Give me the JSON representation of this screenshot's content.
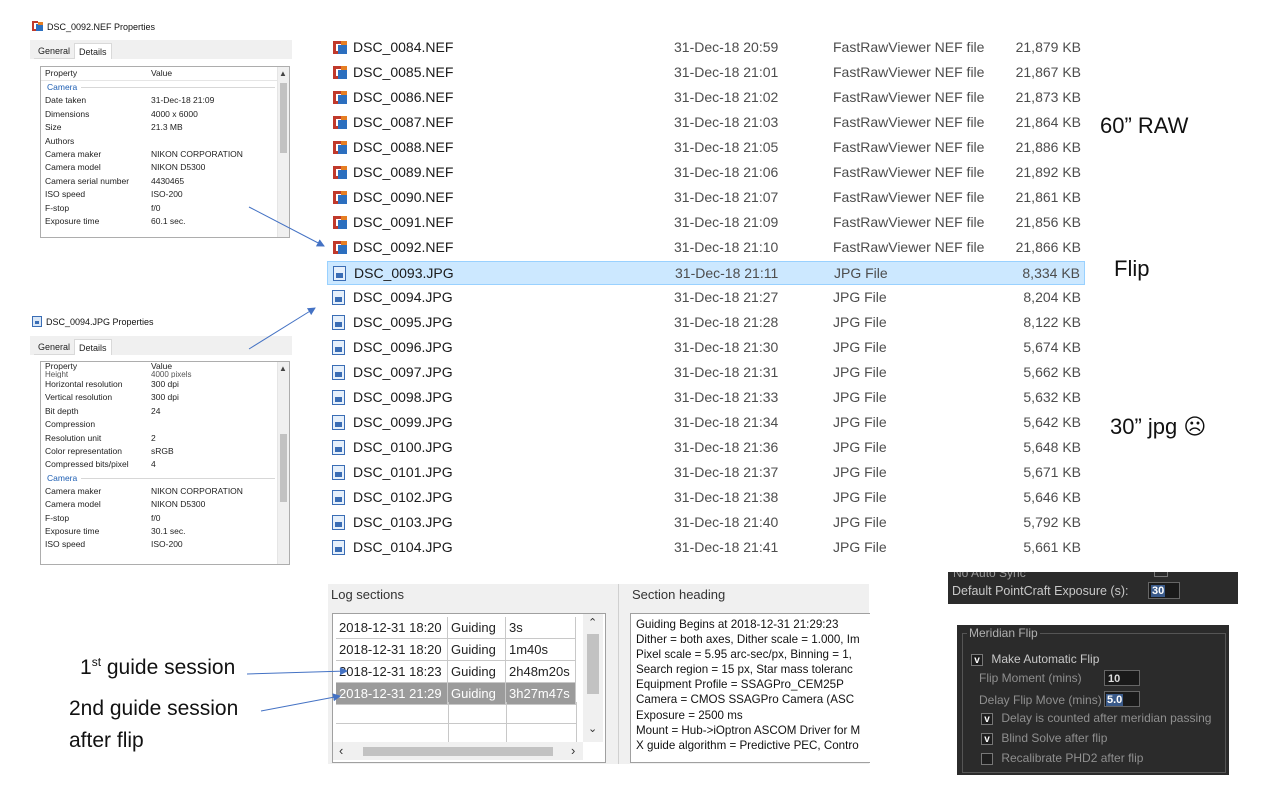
{
  "nef_dialog": {
    "title": "DSC_0092.NEF Properties",
    "tabs": [
      "General",
      "Details"
    ],
    "headers": {
      "property": "Property",
      "value": "Value"
    },
    "section": "Camera",
    "rows": [
      {
        "k": "Date taken",
        "v": "31-Dec-18 21:09"
      },
      {
        "k": "Dimensions",
        "v": "4000 x 6000"
      },
      {
        "k": "Size",
        "v": "21.3 MB"
      },
      {
        "k": "Authors",
        "v": ""
      },
      {
        "k": "Camera maker",
        "v": "NIKON CORPORATION"
      },
      {
        "k": "Camera model",
        "v": "NIKON D5300"
      },
      {
        "k": "Camera serial number",
        "v": "4430465"
      },
      {
        "k": "ISO speed",
        "v": "ISO-200"
      },
      {
        "k": "F-stop",
        "v": "f/0"
      },
      {
        "k": "Exposure time",
        "v": "60.1 sec."
      }
    ]
  },
  "jpg_dialog": {
    "title": "DSC_0094.JPG Properties",
    "tabs": [
      "General",
      "Details"
    ],
    "headers": {
      "property": "Property",
      "value": "Value"
    },
    "partial_row": {
      "k": "Height",
      "v": "4000 pixels"
    },
    "rows": [
      {
        "k": "Horizontal resolution",
        "v": "300 dpi"
      },
      {
        "k": "Vertical resolution",
        "v": "300 dpi"
      },
      {
        "k": "Bit depth",
        "v": "24"
      },
      {
        "k": "Compression",
        "v": ""
      },
      {
        "k": "Resolution unit",
        "v": "2"
      },
      {
        "k": "Color representation",
        "v": "sRGB"
      },
      {
        "k": "Compressed bits/pixel",
        "v": "4"
      }
    ],
    "section": "Camera",
    "rows2": [
      {
        "k": "Camera maker",
        "v": "NIKON CORPORATION"
      },
      {
        "k": "Camera model",
        "v": "NIKON D5300"
      },
      {
        "k": "F-stop",
        "v": "f/0"
      },
      {
        "k": "Exposure time",
        "v": "30.1 sec."
      },
      {
        "k": "ISO speed",
        "v": "ISO-200"
      }
    ]
  },
  "files": [
    {
      "name": "DSC_0084.NEF",
      "date": "31-Dec-18 20:59",
      "type": "FastRawViewer NEF file",
      "size": "21,879 KB",
      "kind": "nef"
    },
    {
      "name": "DSC_0085.NEF",
      "date": "31-Dec-18 21:01",
      "type": "FastRawViewer NEF file",
      "size": "21,867 KB",
      "kind": "nef"
    },
    {
      "name": "DSC_0086.NEF",
      "date": "31-Dec-18 21:02",
      "type": "FastRawViewer NEF file",
      "size": "21,873 KB",
      "kind": "nef"
    },
    {
      "name": "DSC_0087.NEF",
      "date": "31-Dec-18 21:03",
      "type": "FastRawViewer NEF file",
      "size": "21,864 KB",
      "kind": "nef"
    },
    {
      "name": "DSC_0088.NEF",
      "date": "31-Dec-18 21:05",
      "type": "FastRawViewer NEF file",
      "size": "21,886 KB",
      "kind": "nef"
    },
    {
      "name": "DSC_0089.NEF",
      "date": "31-Dec-18 21:06",
      "type": "FastRawViewer NEF file",
      "size": "21,892 KB",
      "kind": "nef"
    },
    {
      "name": "DSC_0090.NEF",
      "date": "31-Dec-18 21:07",
      "type": "FastRawViewer NEF file",
      "size": "21,861 KB",
      "kind": "nef"
    },
    {
      "name": "DSC_0091.NEF",
      "date": "31-Dec-18 21:09",
      "type": "FastRawViewer NEF file",
      "size": "21,856 KB",
      "kind": "nef"
    },
    {
      "name": "DSC_0092.NEF",
      "date": "31-Dec-18 21:10",
      "type": "FastRawViewer NEF file",
      "size": "21,866 KB",
      "kind": "nef"
    },
    {
      "name": "DSC_0093.JPG",
      "date": "31-Dec-18 21:11",
      "type": "JPG File",
      "size": "8,334 KB",
      "kind": "jpg",
      "selected": true
    },
    {
      "name": "DSC_0094.JPG",
      "date": "31-Dec-18 21:27",
      "type": "JPG File",
      "size": "8,204 KB",
      "kind": "jpg"
    },
    {
      "name": "DSC_0095.JPG",
      "date": "31-Dec-18 21:28",
      "type": "JPG File",
      "size": "8,122 KB",
      "kind": "jpg"
    },
    {
      "name": "DSC_0096.JPG",
      "date": "31-Dec-18 21:30",
      "type": "JPG File",
      "size": "5,674 KB",
      "kind": "jpg"
    },
    {
      "name": "DSC_0097.JPG",
      "date": "31-Dec-18 21:31",
      "type": "JPG File",
      "size": "5,662 KB",
      "kind": "jpg"
    },
    {
      "name": "DSC_0098.JPG",
      "date": "31-Dec-18 21:33",
      "type": "JPG File",
      "size": "5,632 KB",
      "kind": "jpg"
    },
    {
      "name": "DSC_0099.JPG",
      "date": "31-Dec-18 21:34",
      "type": "JPG File",
      "size": "5,642 KB",
      "kind": "jpg"
    },
    {
      "name": "DSC_0100.JPG",
      "date": "31-Dec-18 21:36",
      "type": "JPG File",
      "size": "5,648 KB",
      "kind": "jpg"
    },
    {
      "name": "DSC_0101.JPG",
      "date": "31-Dec-18 21:37",
      "type": "JPG File",
      "size": "5,671 KB",
      "kind": "jpg"
    },
    {
      "name": "DSC_0102.JPG",
      "date": "31-Dec-18 21:38",
      "type": "JPG File",
      "size": "5,646 KB",
      "kind": "jpg"
    },
    {
      "name": "DSC_0103.JPG",
      "date": "31-Dec-18 21:40",
      "type": "JPG File",
      "size": "5,792 KB",
      "kind": "jpg"
    },
    {
      "name": "DSC_0104.JPG",
      "date": "31-Dec-18 21:41",
      "type": "JPG File",
      "size": "5,661 KB",
      "kind": "jpg"
    }
  ],
  "notes": {
    "raw": "60” RAW",
    "flip": "Flip",
    "jpg": "30” jpg ☹"
  },
  "log": {
    "sections_header": "Log sections",
    "heading_header": "Section heading",
    "rows": [
      {
        "time": "2018-12-31 18:20",
        "type": "Guiding",
        "dur": "3s"
      },
      {
        "time": "2018-12-31 18:20",
        "type": "Guiding",
        "dur": "1m40s"
      },
      {
        "time": "2018-12-31 18:23",
        "type": "Guiding",
        "dur": "2h48m20s"
      },
      {
        "time": "2018-12-31 21:29",
        "type": "Guiding",
        "dur": "3h27m47s",
        "selected": true
      }
    ],
    "heading_lines": [
      "Guiding Begins at 2018-12-31 21:29:23",
      "Dither = both axes, Dither scale = 1.000, Im",
      "Pixel scale = 5.95 arc-sec/px, Binning = 1,",
      "Search region = 15 px, Star mass toleranc",
      "Equipment Profile = SSAGPro_CEM25P",
      "Camera = CMOS SSAGPro Camera (ASC",
      "Exposure = 2500 ms",
      "Mount = Hub->iOptron ASCOM Driver for M",
      "X guide algorithm = Predictive PEC, Contro"
    ]
  },
  "labels": {
    "first_num": "1",
    "first_sup": "st",
    "first_rest": " guide session",
    "second_line1": "2nd guide session",
    "second_line2": "after flip"
  },
  "pointcraft": {
    "cut_text": "No Auto Sync",
    "label": "Default PointCraft Exposure (s):",
    "value": "30"
  },
  "meridian": {
    "title": "Meridian Flip",
    "make_auto": "Make Automatic Flip",
    "flip_moment_label": "Flip Moment (mins)",
    "flip_moment_value": "10",
    "delay_label": "Delay Flip Move (mins)",
    "delay_value": "5.0",
    "opt1": "Delay is counted after meridian passing",
    "opt2": "Blind Solve after flip",
    "opt3": "Recalibrate PHD2 after flip",
    "check": "v"
  },
  "colors": {
    "selection": "#cce8ff",
    "arrow": "#4472c4",
    "section_blue": "#1e5fb4"
  }
}
